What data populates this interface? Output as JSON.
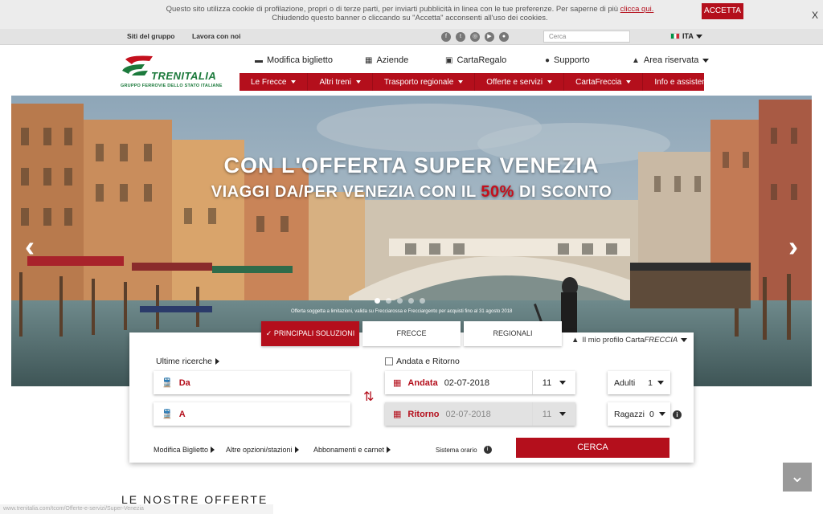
{
  "cookie": {
    "line1": "Questo sito utilizza cookie di profilazione, propri o di terze parti, per inviarti pubblicità in linea con le tue preferenze. Per saperne di più",
    "link": "clicca qui.",
    "line2": "Chiudendo questo banner o cliccando su \"Accetta\" acconsenti all'uso dei cookies.",
    "accept": "ACCETTA",
    "close": "X"
  },
  "utility": {
    "gruppo": "Siti del gruppo",
    "lavora": "Lavora con noi",
    "search_placeholder": "Cerca",
    "lang": "ITA"
  },
  "logo": {
    "name": "TRENITALIA",
    "sub": "GRUPPO FERROVIE DELLO STATO ITALIANE"
  },
  "toplinks": {
    "modifica": "Modifica biglietto",
    "aziende": "Aziende",
    "carta_regalo": "CartaRegalo",
    "supporto": "Supporto",
    "area": "Area riservata"
  },
  "nav": [
    "Le Frecce",
    "Altri treni",
    "Trasporto regionale",
    "Offerte e servizi",
    "CartaFreccia",
    "Info e assistenza"
  ],
  "hero": {
    "title": "CON L'OFFERTA SUPER VENEZIA",
    "subtitle_a": "VIAGGI DA/PER VENEZIA CON IL ",
    "subtitle_pct": "50%",
    "subtitle_b": " DI SCONTO",
    "fine": "Offerta soggetta a limitazioni, valida su Frecciarossa e Frecciargento per acquisti fino al 31 agosto 2018",
    "active_slide": 1
  },
  "booking": {
    "tabs": [
      "PRINCIPALI SOLUZIONI",
      "FRECCE",
      "REGIONALI"
    ],
    "profile_a": "Il mio profilo Carta",
    "profile_b": "FRECCIA",
    "ultime": "Ultime ricerche",
    "andata_ritorno": "Andata e Ritorno",
    "da": "Da",
    "a": "A",
    "andata_label": "Andata",
    "andata_date": "02-07-2018",
    "andata_hour": "11",
    "ritorno_label": "Ritorno",
    "ritorno_date": "02-07-2018",
    "ritorno_hour": "11",
    "adulti_label": "Adulti",
    "adulti_value": "1",
    "ragazzi_label": "Ragazzi",
    "ragazzi_value": "0",
    "modifica": "Modifica Biglietto",
    "altre": "Altre opzioni/stazioni",
    "abbonamenti": "Abbonamenti e carnet",
    "sistema": "Sistema orario",
    "cerca": "CERCA"
  },
  "offerte_title": "LE NOSTRE OFFERTE",
  "status_url": "www.trenitalia.com/tcom/Offerte-e-servizi/Super-Venezia",
  "colors": {
    "brand": "#b40f1c",
    "logo_green": "#1c7a3c"
  }
}
